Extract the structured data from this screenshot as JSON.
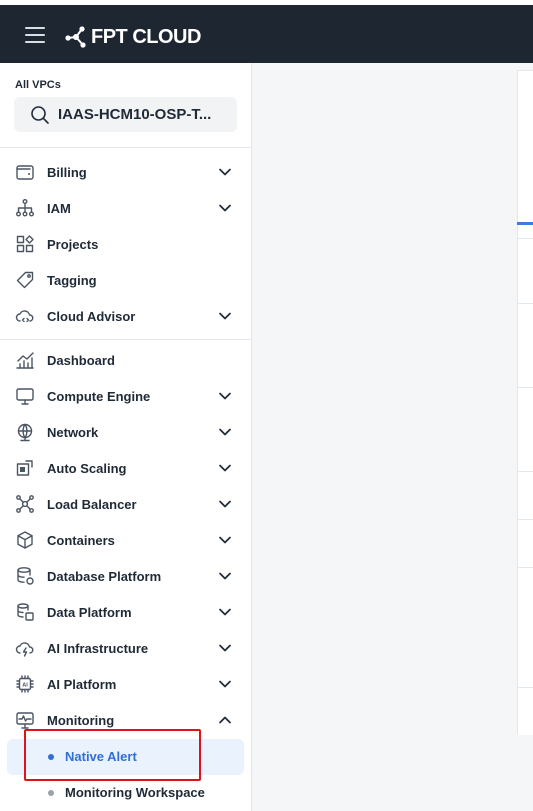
{
  "header": {
    "logo_text": "FPT CLOUD"
  },
  "vpc": {
    "label": "All VPCs",
    "selected": "IAAS-HCM10-OSP-T..."
  },
  "sidebar": {
    "account_items": [
      {
        "label": "Billing",
        "icon": "wallet-icon",
        "expandable": true
      },
      {
        "label": "IAM",
        "icon": "hierarchy-icon",
        "expandable": true
      },
      {
        "label": "Projects",
        "icon": "projects-icon",
        "expandable": false
      },
      {
        "label": "Tagging",
        "icon": "tag-icon",
        "expandable": false
      },
      {
        "label": "Cloud Advisor",
        "icon": "cloud-advisor-icon",
        "expandable": true
      }
    ],
    "service_items": [
      {
        "label": "Dashboard",
        "icon": "chart-icon",
        "expandable": false
      },
      {
        "label": "Compute Engine",
        "icon": "monitor-icon",
        "expandable": true
      },
      {
        "label": "Network",
        "icon": "globe-icon",
        "expandable": true
      },
      {
        "label": "Auto Scaling",
        "icon": "autoscaling-icon",
        "expandable": true
      },
      {
        "label": "Load Balancer",
        "icon": "load-balancer-icon",
        "expandable": true
      },
      {
        "label": "Containers",
        "icon": "cube-icon",
        "expandable": true
      },
      {
        "label": "Database Platform",
        "icon": "database-icon",
        "expandable": true
      },
      {
        "label": "Data Platform",
        "icon": "data-platform-icon",
        "expandable": true
      },
      {
        "label": "AI Infrastructure",
        "icon": "ai-infra-icon",
        "expandable": true
      },
      {
        "label": "AI Platform",
        "icon": "ai-chip-icon",
        "expandable": true
      },
      {
        "label": "Monitoring",
        "icon": "monitoring-icon",
        "expandable": true,
        "expanded": true
      }
    ],
    "monitoring_sub": [
      {
        "label": "Native Alert",
        "active": true
      },
      {
        "label": "Monitoring Workspace",
        "active": false
      }
    ]
  },
  "colors": {
    "header_bg": "#1e2731",
    "accent": "#2f6fd6",
    "highlight": "#e0131d"
  }
}
